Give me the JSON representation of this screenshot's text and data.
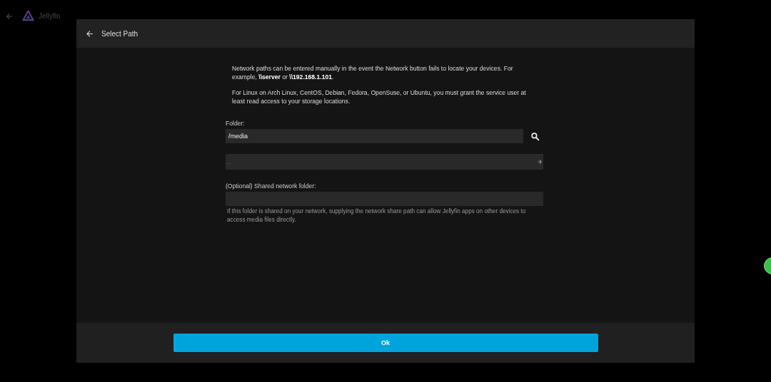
{
  "app_header": {
    "brand": "Jellyfin"
  },
  "dialog": {
    "title": "Select Path",
    "instructions": [
      "Network paths can be entered manually in the event the Network button fails to locate your devices. For example, **\\\\server** or **\\\\192.168.1.101**.",
      "For Linux on Arch Linux, CentOS, Debian, Fedora, OpenSuse, or Ubuntu, you must grant the service user at least read access to your storage locations."
    ],
    "folder": {
      "label": "Folder:",
      "value": "/media"
    },
    "directory_list": [
      {
        "name": "..."
      }
    ],
    "shared_folder": {
      "label": "(Optional) Shared network folder:",
      "help": "If this folder is shared on your network, supplying the network share path can allow Jellyfin apps on other devices to access media files directly."
    },
    "ok_button": "Ok"
  }
}
